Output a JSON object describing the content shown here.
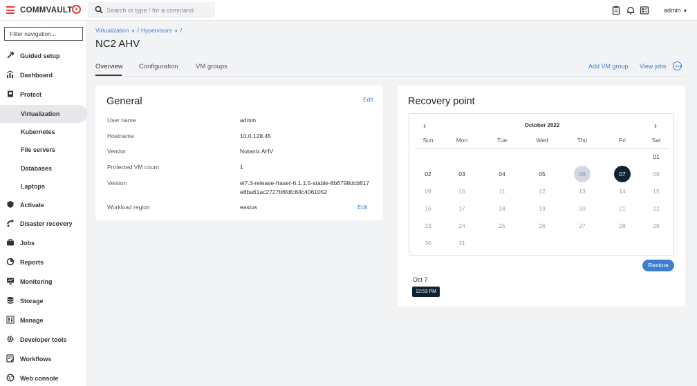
{
  "header": {
    "brand": "COMMVAULT",
    "search_placeholder": "Search or type / for a command",
    "user": "admin"
  },
  "sidebar": {
    "filter_placeholder": "Filter navigation...",
    "items": [
      {
        "label": "Guided setup",
        "icon": "guided-setup-icon"
      },
      {
        "label": "Dashboard",
        "icon": "dashboard-icon"
      },
      {
        "label": "Protect",
        "icon": "protect-icon"
      },
      {
        "label": "Virtualization",
        "active": true
      },
      {
        "label": "Kubernetes"
      },
      {
        "label": "File servers"
      },
      {
        "label": "Databases"
      },
      {
        "label": "Laptops"
      },
      {
        "label": "Activate",
        "icon": "activate-icon"
      },
      {
        "label": "Disaster recovery",
        "icon": "disaster-recovery-icon"
      },
      {
        "label": "Jobs",
        "icon": "jobs-icon"
      },
      {
        "label": "Reports",
        "icon": "reports-icon"
      },
      {
        "label": "Monitoring",
        "icon": "monitoring-icon"
      },
      {
        "label": "Storage",
        "icon": "storage-icon"
      },
      {
        "label": "Manage",
        "icon": "manage-icon"
      },
      {
        "label": "Developer tools",
        "icon": "developer-tools-icon"
      },
      {
        "label": "Workflows",
        "icon": "workflows-icon"
      },
      {
        "label": "Web console",
        "icon": "web-console-icon"
      }
    ]
  },
  "breadcrumb": {
    "items": [
      "Virtualization",
      "Hypervisors"
    ]
  },
  "page": {
    "title": "NC2 AHV",
    "tabs": [
      "Overview",
      "Configuration",
      "VM groups"
    ],
    "actions": {
      "add_vm_group": "Add VM group",
      "view_jobs": "View jobs"
    }
  },
  "general": {
    "title": "General",
    "edit_label": "Edit",
    "properties": [
      {
        "label": "User name",
        "value": "admin"
      },
      {
        "label": "Hostname",
        "value": "10.0.128.45"
      },
      {
        "label": "Vendor",
        "value": "Nutanix AHV"
      },
      {
        "label": "Protected VM count",
        "value": "1"
      },
      {
        "label": "Version",
        "value": "el7.3-release-fraser-6.1.1.5-stable-8b6798dcb817e8ba61ac2727b6fdfc84c4061052"
      },
      {
        "label": "Workload region",
        "value": "eastus"
      }
    ],
    "region_edit_label": "Edit"
  },
  "recovery": {
    "title": "Recovery point",
    "month": "October 2022",
    "weekdays": [
      "Sun",
      "Mon",
      "Tue",
      "Wed",
      "Thu",
      "Fri",
      "Sat"
    ],
    "days": [
      "01",
      "02",
      "03",
      "04",
      "05",
      "06",
      "07",
      "08",
      "09",
      "10",
      "11",
      "12",
      "13",
      "14",
      "15",
      "16",
      "17",
      "18",
      "19",
      "20",
      "21",
      "22",
      "23",
      "24",
      "25",
      "26",
      "27",
      "28",
      "29",
      "30",
      "31"
    ],
    "available_days": [
      "02",
      "03",
      "04",
      "05"
    ],
    "highlighted_day": "06",
    "selected_day": "07",
    "restore_label": "Restore",
    "point_date": "Oct 7",
    "point_time": "12:53 PM"
  },
  "colors": {
    "accent": "#3d7fcc",
    "brand": "#e03a3e",
    "selected": "#0d2233"
  }
}
